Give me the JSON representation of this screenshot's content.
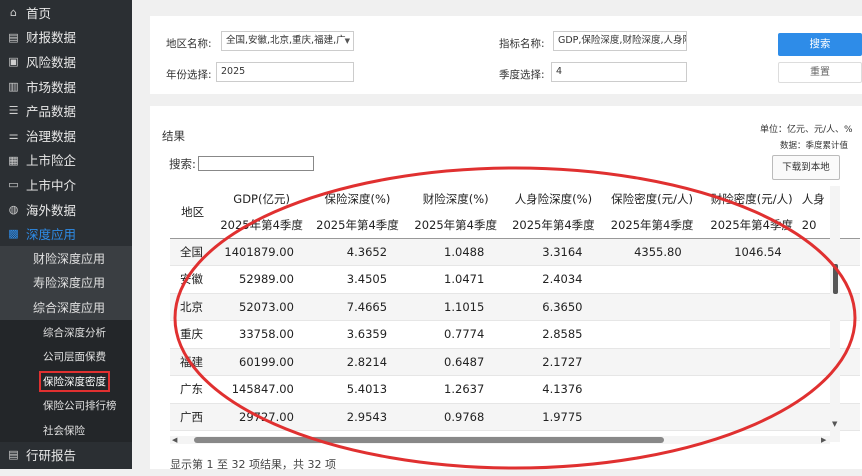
{
  "sidebar": {
    "items": [
      {
        "label": "首页",
        "icon": "home-icon"
      },
      {
        "label": "财报数据",
        "icon": "document-icon"
      },
      {
        "label": "风险数据",
        "icon": "image-icon"
      },
      {
        "label": "市场数据",
        "icon": "bar-chart-icon"
      },
      {
        "label": "产品数据",
        "icon": "list-icon"
      },
      {
        "label": "治理数据",
        "icon": "sliders-icon"
      },
      {
        "label": "上市险企",
        "icon": "building-icon"
      },
      {
        "label": "上市中介",
        "icon": "monitor-icon"
      },
      {
        "label": "海外数据",
        "icon": "globe-icon"
      },
      {
        "label": "深度应用",
        "icon": "grid-icon"
      }
    ],
    "subitems": [
      "财险深度应用",
      "寿险深度应用",
      "综合深度应用"
    ],
    "subsubitems": [
      "综合深度分析",
      "公司层面保费",
      "保险深度密度",
      "保险公司排行榜",
      "社会保险"
    ],
    "bottom_item": {
      "label": "行研报告",
      "icon": "report-icon"
    }
  },
  "filters": {
    "region_label": "地区名称:",
    "region_value": "全国,安徽,北京,重庆,福建,广",
    "indicator_label": "指标名称:",
    "indicator_value": "GDP,保险深度,财险深度,人身险深",
    "year_label": "年份选择:",
    "year_value": "2025",
    "quarter_label": "季度选择:",
    "quarter_value": "4",
    "search_button": "搜索",
    "reset_button": "重置"
  },
  "results": {
    "title": "结果",
    "unit_note": "单位：亿元、元/人、%",
    "data_note": "数据：季度累计值",
    "download_button": "下载到本地",
    "search_label": "搜索:",
    "footer": "显示第 1 至 32 项结果，共 32 项"
  },
  "table": {
    "region_header": "地区",
    "columns": [
      "GDP(亿元)",
      "保险深度(%)",
      "财险深度(%)",
      "人身险深度(%)",
      "保险密度(元/人)",
      "财险密度(元/人)",
      "人身"
    ],
    "period": [
      "2025年第4季度",
      "2025年第4季度",
      "2025年第4季度",
      "2025年第4季度",
      "2025年第4季度",
      "2025年第4季度",
      "20"
    ],
    "rows": [
      [
        "全国",
        "1401879.00",
        "4.3652",
        "1.0488",
        "3.3164",
        "4355.80",
        "1046.54"
      ],
      [
        "安徽",
        "52989.00",
        "3.4505",
        "1.0471",
        "2.4034",
        "",
        ""
      ],
      [
        "北京",
        "52073.00",
        "7.4665",
        "1.1015",
        "6.3650",
        "",
        ""
      ],
      [
        "重庆",
        "33758.00",
        "3.6359",
        "0.7774",
        "2.8585",
        "",
        ""
      ],
      [
        "福建",
        "60199.00",
        "2.8214",
        "0.6487",
        "2.1727",
        "",
        ""
      ],
      [
        "广东",
        "145847.00",
        "5.4013",
        "1.2637",
        "4.1376",
        "",
        ""
      ],
      [
        "广西",
        "29727.00",
        "2.9543",
        "0.9768",
        "1.9775",
        "",
        ""
      ]
    ]
  },
  "colors": {
    "accent": "#2e8ce8",
    "annotation": "#e03030",
    "sidebar_bg": "#2b2f33"
  }
}
